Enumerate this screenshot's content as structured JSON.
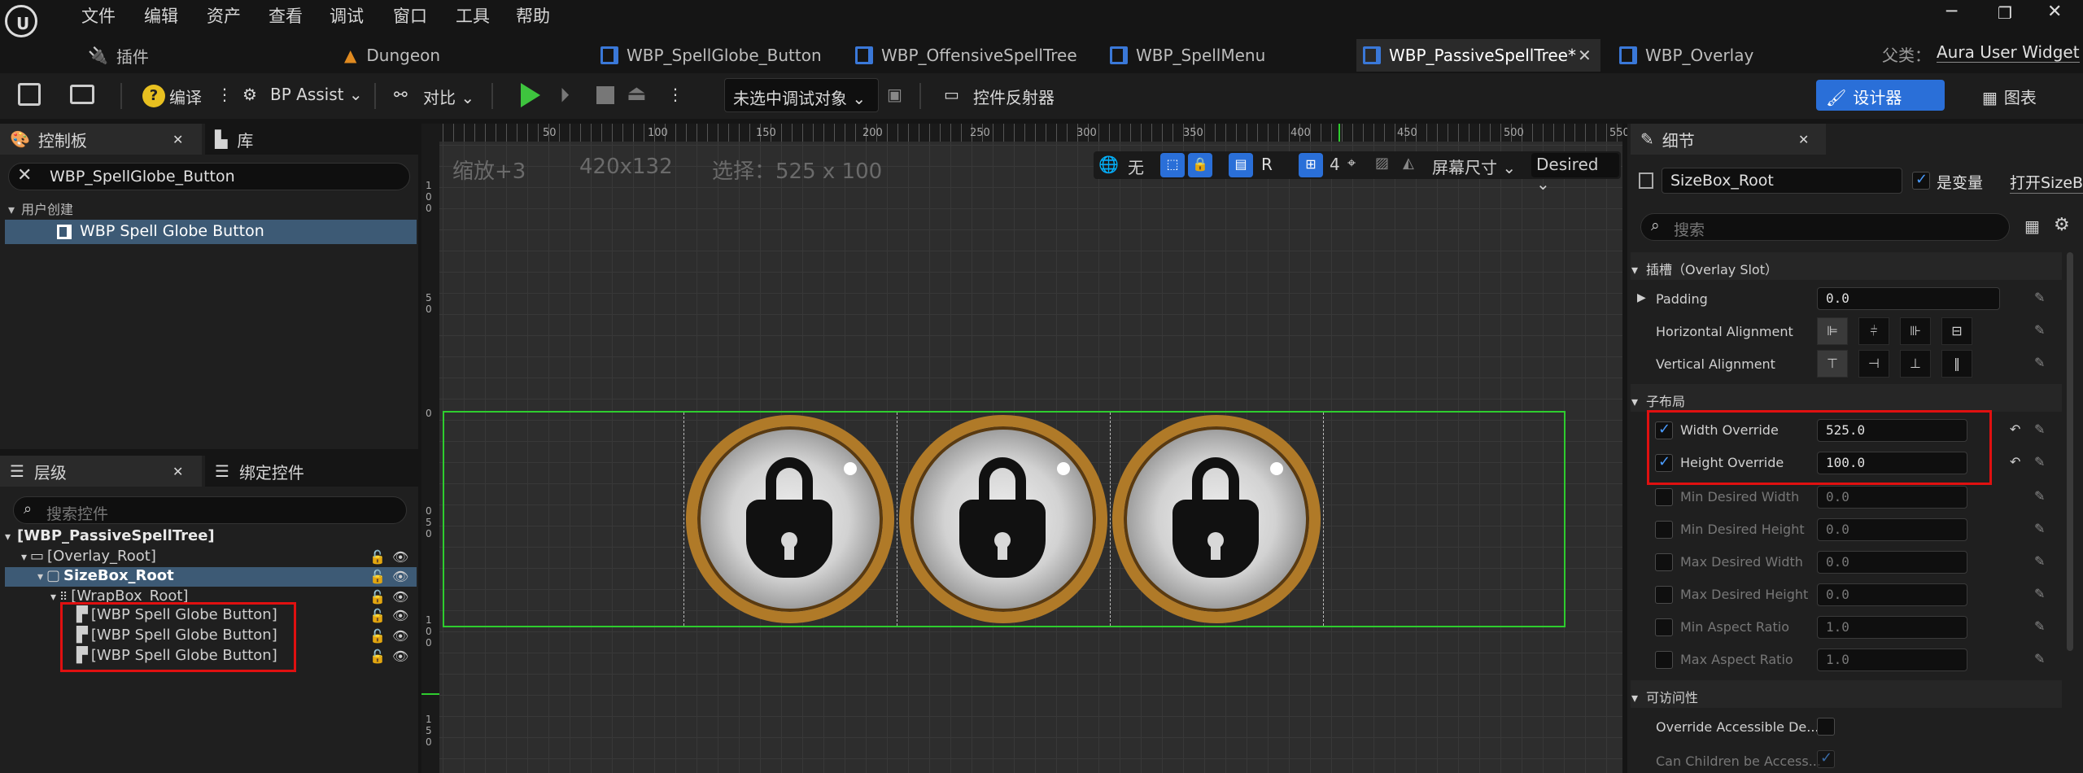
{
  "menu": [
    "文件",
    "编辑",
    "资产",
    "查看",
    "调试",
    "窗口",
    "工具",
    "帮助"
  ],
  "tabs": [
    {
      "label": "插件"
    },
    {
      "label": "Dungeon"
    },
    {
      "label": "WBP_SpellGlobe_Button"
    },
    {
      "label": "WBP_OffensiveSpellTree"
    },
    {
      "label": "WBP_SpellMenu"
    },
    {
      "label": "WBP_PassiveSpellTree*"
    },
    {
      "label": "WBP_Overlay"
    }
  ],
  "parent_class": {
    "label": "父类：",
    "value": "Aura User Widget"
  },
  "toolbar": {
    "compile": "编译",
    "bp_assist": "BP Assist",
    "diff": "对比",
    "debug_target": "未选中调试对象",
    "widget_reflector": "控件反射器",
    "designer": "设计器",
    "graph": "图表"
  },
  "palette": {
    "tab_palette": "控制板",
    "tab_library": "库",
    "search_value": "WBP_SpellGlobe_Button",
    "category": "用户创建",
    "item": "WBP Spell Globe Button"
  },
  "hierarchy": {
    "tab_hierarchy": "层级",
    "tab_bind": "绑定控件",
    "search_placeholder": "搜索控件",
    "rows": [
      "[WBP_PassiveSpellTree]",
      "[Overlay_Root]",
      "SizeBox_Root",
      "[WrapBox_Root]",
      "[WBP Spell Globe Button]",
      "[WBP Spell Globe Button]",
      "[WBP Spell Globe Button]"
    ]
  },
  "canvas": {
    "zoom": "缩放+3",
    "size": "420x132",
    "selection": "选择：525 x 100",
    "toggle_none": "无",
    "toggle_r": "R",
    "grid_count": "4",
    "screen_size": "屏幕尺寸",
    "desired": "Desired",
    "ruler_top": [
      "50",
      "100",
      "150",
      "200",
      "250",
      "300",
      "350",
      "400",
      "450",
      "500",
      "550"
    ],
    "ruler_left": [
      "1",
      "0",
      "0",
      "5",
      "0",
      "0",
      "0",
      "5",
      "0",
      "1",
      "0",
      "0",
      "1",
      "5",
      "0"
    ]
  },
  "details": {
    "tab": "细节",
    "widget_name": "SizeBox_Root",
    "is_variable": "是变量",
    "open_link": "打开SizeB",
    "search_placeholder": "搜索",
    "slot_section": "插槽（Overlay Slot）",
    "padding_label": "Padding",
    "padding_value": "0.0",
    "h_align_label": "Horizontal Alignment",
    "v_align_label": "Vertical Alignment",
    "child_layout": "子布局",
    "width_override_label": "Width Override",
    "width_override_value": "525.0",
    "height_override_label": "Height Override",
    "height_override_value": "100.0",
    "min_w_label": "Min Desired Width",
    "min_w_value": "0.0",
    "min_h_label": "Min Desired Height",
    "min_h_value": "0.0",
    "max_w_label": "Max Desired Width",
    "max_w_value": "0.0",
    "max_h_label": "Max Desired Height",
    "max_h_value": "0.0",
    "min_ar_label": "Min Aspect Ratio",
    "min_ar_value": "1.0",
    "max_ar_label": "Max Aspect Ratio",
    "max_ar_value": "1.0",
    "accessibility": "可访问性",
    "override_acc_label": "Override Accessible De...",
    "children_acc_label": "Can Children be Access..."
  },
  "colors": {
    "accent": "#2a6fd8",
    "selection_outline": "#2ecc2e",
    "highlight_box": "#e01010",
    "globe_rim": "#b07a28"
  }
}
